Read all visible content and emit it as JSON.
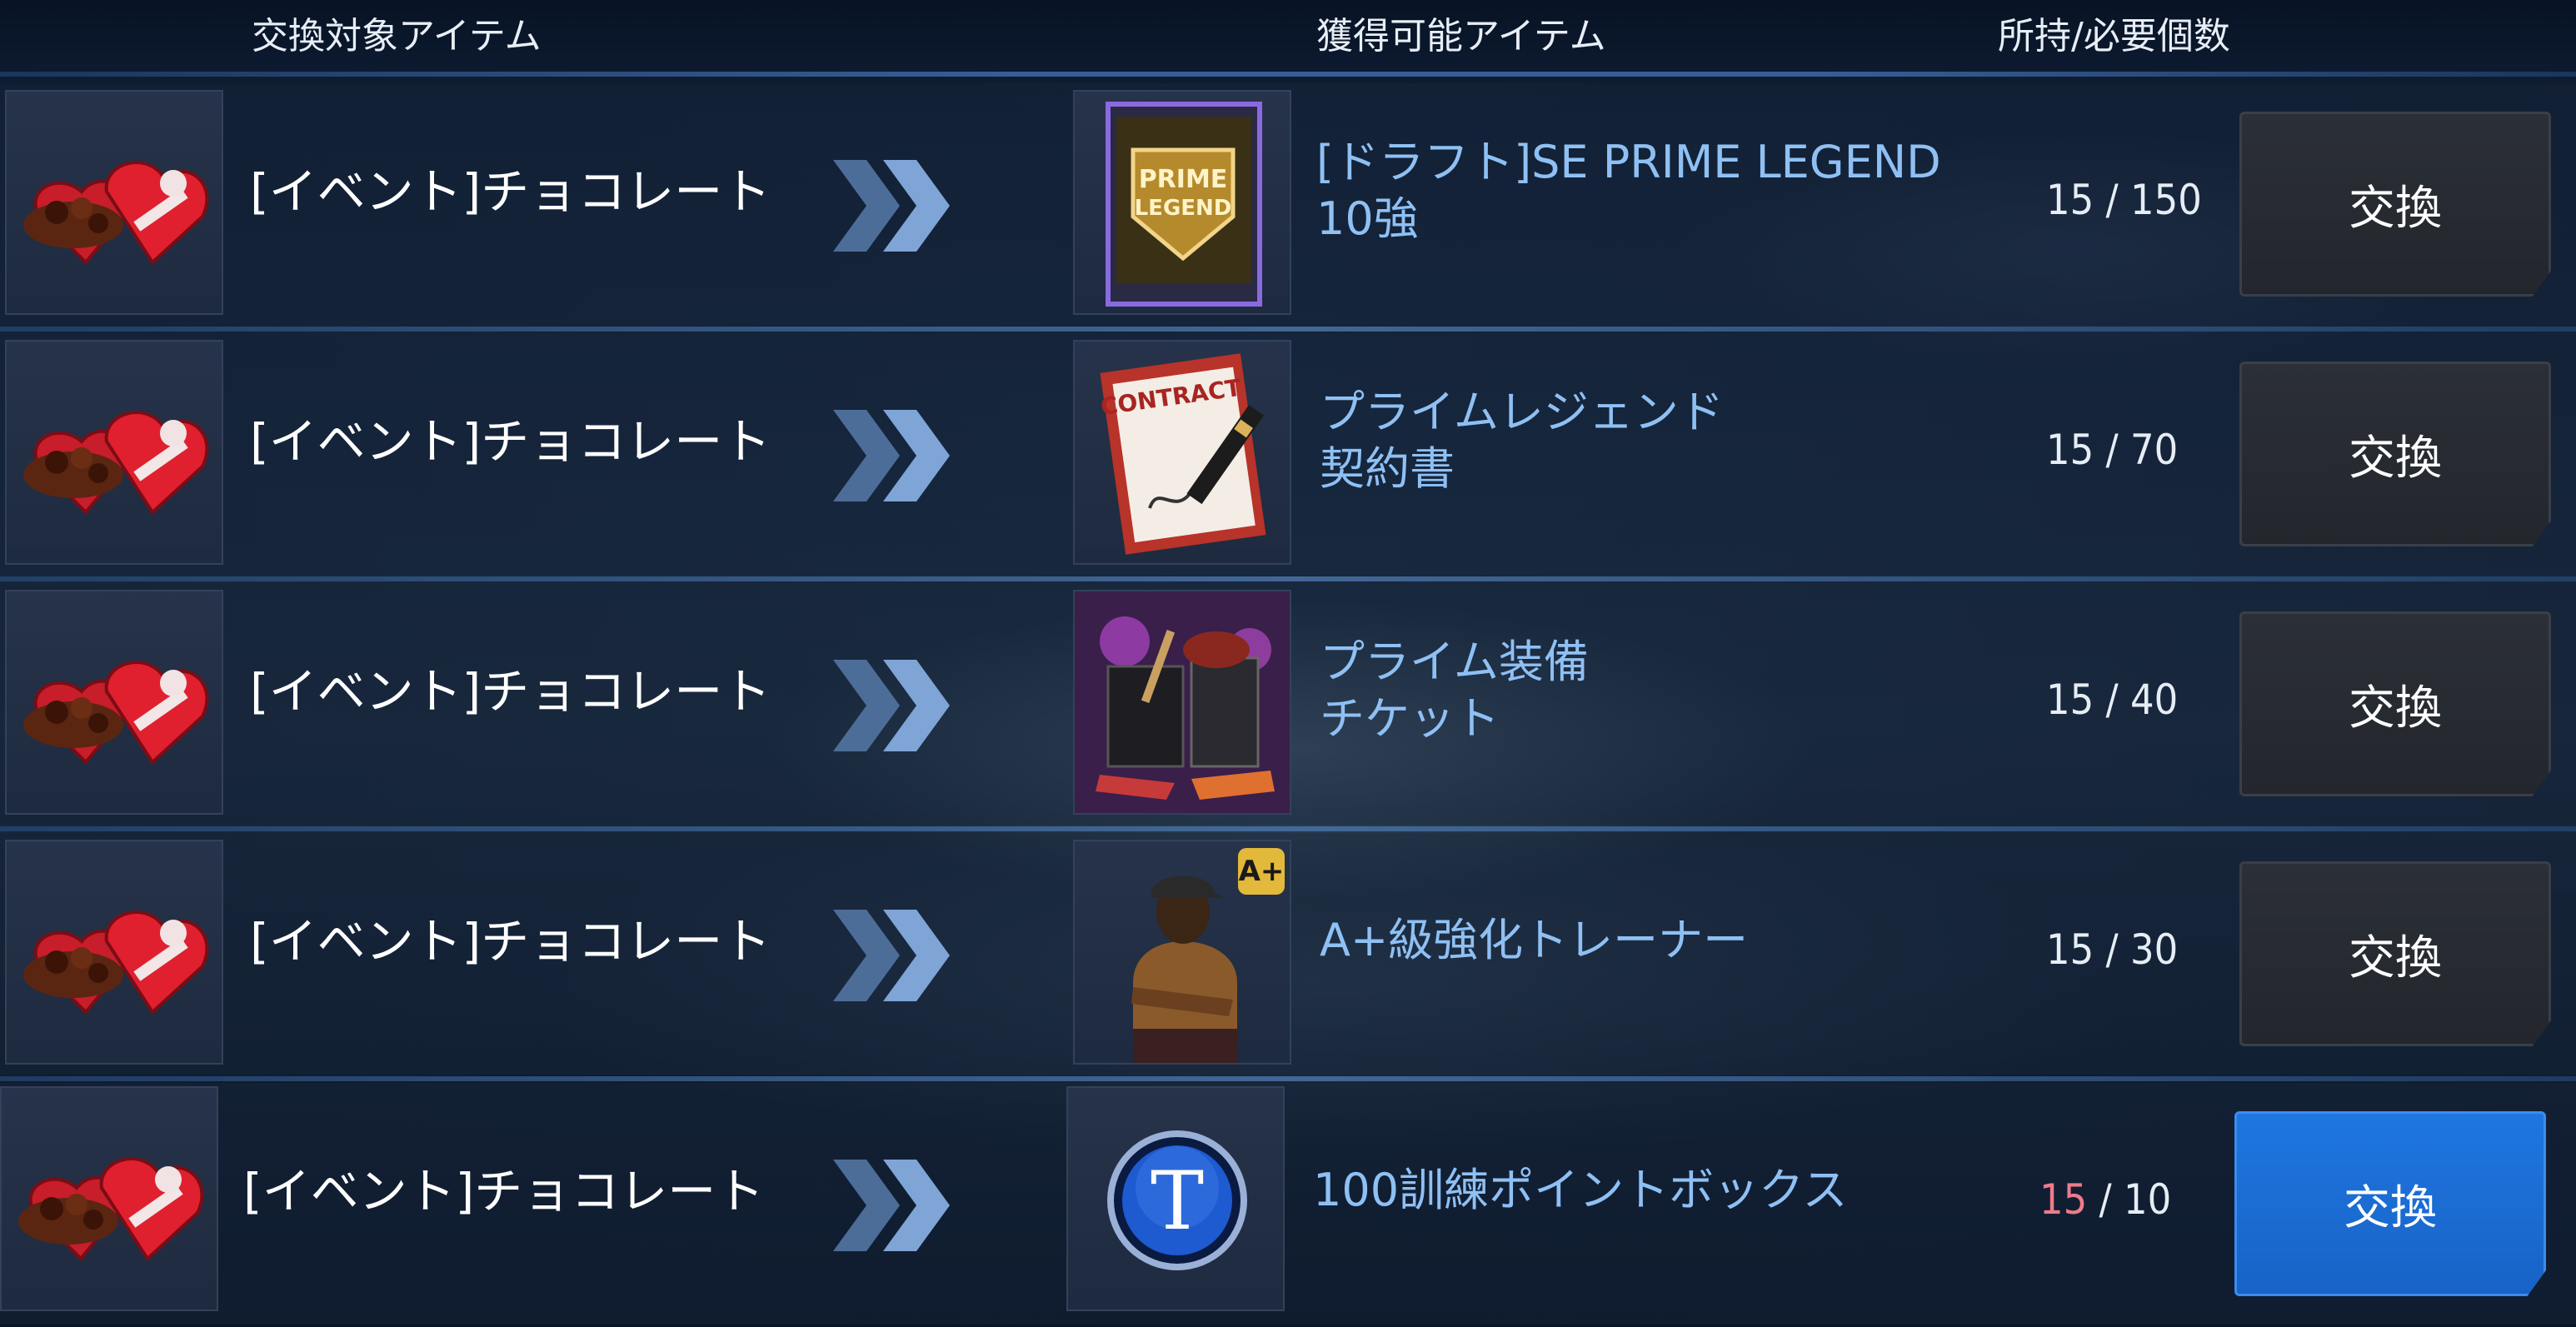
{
  "header": {
    "col_source": "交換対象アイテム",
    "col_reward": "獲得可能アイテム",
    "col_count": "所持/必要個数"
  },
  "rows": [
    {
      "source_label": "[イベント]チョコレート",
      "reward_line1": "[ドラフト]SE PRIME LEGEND",
      "reward_line2": "10強",
      "owned": "15",
      "required": "150",
      "button_label": "交換",
      "button_state": "disabled",
      "reward_icon": "prime-legend-card-icon"
    },
    {
      "source_label": "[イベント]チョコレート",
      "reward_line1": "プライムレジェンド",
      "reward_line2": "契約書",
      "owned": "15",
      "required": "70",
      "button_label": "交換",
      "button_state": "disabled",
      "reward_icon": "contract-icon"
    },
    {
      "source_label": "[イベント]チョコレート",
      "reward_line1": "プライム装備",
      "reward_line2": "チケット",
      "owned": "15",
      "required": "40",
      "button_label": "交換",
      "button_state": "disabled",
      "reward_icon": "equipment-ticket-icon"
    },
    {
      "source_label": "[イベント]チョコレート",
      "reward_line1": "A+級強化トレーナー",
      "reward_line2": "",
      "badge": "A+",
      "owned": "15",
      "required": "30",
      "button_label": "交換",
      "button_state": "disabled",
      "reward_icon": "trainer-icon"
    },
    {
      "source_label": "[イベント]チョコレート",
      "reward_line1": "100訓練ポイントボックス",
      "reward_line2": "",
      "coin_letter": "T",
      "owned": "15",
      "required": "10",
      "button_label": "交換",
      "button_state": "active",
      "reward_icon": "training-point-coin-icon"
    }
  ],
  "count_separator": "/",
  "source_icon": "chocolate-heart-box-icon",
  "colors": {
    "reward_text": "#8fc0f4",
    "owned_insufficient": "#f07a8a",
    "button_active": "#1f76e0",
    "button_inactive": "#2b2f36"
  }
}
